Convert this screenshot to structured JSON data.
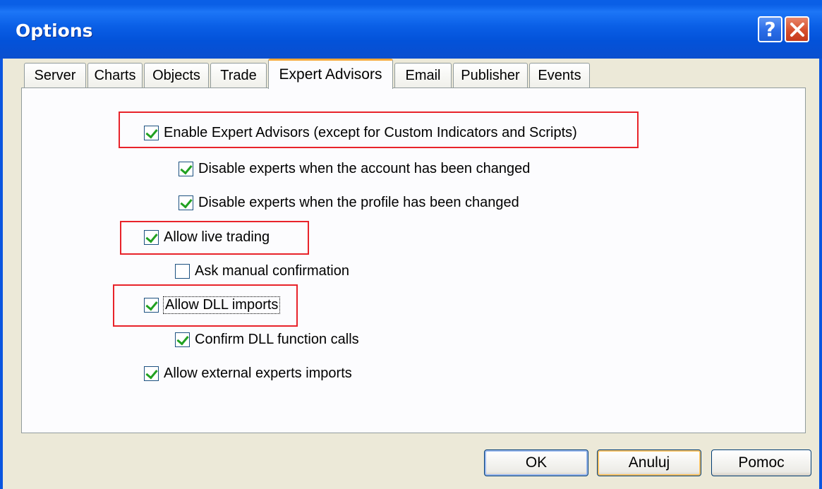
{
  "window": {
    "title": "Options"
  },
  "titlebar": {
    "help_label": "?"
  },
  "tabs": [
    {
      "label": "Server",
      "active": false
    },
    {
      "label": "Charts",
      "active": false
    },
    {
      "label": "Objects",
      "active": false
    },
    {
      "label": "Trade",
      "active": false
    },
    {
      "label": "Expert Advisors",
      "active": true
    },
    {
      "label": "Email",
      "active": false
    },
    {
      "label": "Publisher",
      "active": false
    },
    {
      "label": "Events",
      "active": false
    }
  ],
  "options": [
    {
      "label": "Enable Expert Advisors (except for Custom Indicators and Scripts)",
      "checked": true
    },
    {
      "label": "Disable experts when the account has been changed",
      "checked": true
    },
    {
      "label": "Disable experts when the profile has been changed",
      "checked": true
    },
    {
      "label": "Allow live trading",
      "checked": true
    },
    {
      "label": "Ask manual confirmation",
      "checked": false
    },
    {
      "label": "Allow DLL imports",
      "checked": true
    },
    {
      "label": "Confirm DLL function calls",
      "checked": true
    },
    {
      "label": "Allow external experts imports",
      "checked": true
    }
  ],
  "buttons": {
    "ok": "OK",
    "cancel": "Anuluj",
    "help": "Pomoc"
  },
  "colors": {
    "titlebar": "#0a5fe6",
    "highlight": "#e8232a",
    "active_tab_accent": "#f7a938",
    "check": "#21a121"
  }
}
